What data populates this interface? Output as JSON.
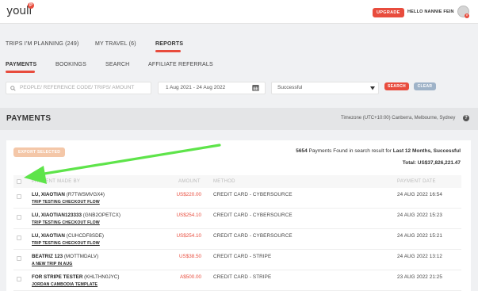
{
  "header": {
    "logo_text": "youli",
    "logo_mark": "P",
    "upgrade_label": "UPGRADE",
    "greeting": "HELLO NANNIE FEIN",
    "avatar_icon": "user-avatar-icon",
    "avatar_badge": "×"
  },
  "nav": {
    "tabs": [
      {
        "label": "TRIPS I'M PLANNING (249)"
      },
      {
        "label": "MY TRAVEL (6)"
      },
      {
        "label": "REPORTS"
      }
    ],
    "subtabs": [
      {
        "label": "PAYMENTS"
      },
      {
        "label": "BOOKINGS"
      },
      {
        "label": "SEARCH"
      },
      {
        "label": "AFFILIATE REFERRALS"
      }
    ]
  },
  "filters": {
    "search_placeholder": "PEOPLE/ REFERENCE CODE/ TRIPS/ AMOUNT",
    "date_range": "1 Aug 2021 - 24 Aug 2022",
    "status": "Successful",
    "search_label": "SEARCH",
    "clear_label": "CLEAR"
  },
  "section": {
    "title": "PAYMENTS",
    "timezone": "Timezone (UTC+10:00) Canberra, Melbourne, Sydney",
    "info_icon": "?"
  },
  "results": {
    "export_label": "EXPORT SELECTED",
    "count": "5654",
    "found_text": " Payments Found in search result for ",
    "range_text": "Last 12 Months, Successful",
    "total_text": "Total: US$37,826,221.47"
  },
  "table": {
    "headers": {
      "made_by": "PAYMENT MADE BY",
      "amount": "AMOUNT",
      "method": "METHOD",
      "date": "PAYMENT DATE"
    },
    "rows": [
      {
        "name": "LU, XIAOTIAN",
        "ref": "(R7TWSMVGX4)",
        "trip": "TRIP TESTING CHECKOUT FLOW",
        "amount": "US$220.00",
        "method": "CREDIT CARD - CYBERSOURCE",
        "date": "24 AUG 2022 16:54"
      },
      {
        "name": "LU, XIAOTIAN123333",
        "ref": "(GNB2OPETCX)",
        "trip": "TRIP TESTING CHECKOUT FLOW",
        "amount": "US$254.10",
        "method": "CREDIT CARD - CYBERSOURCE",
        "date": "24 AUG 2022 15:23"
      },
      {
        "name": "LU, XIAOTIAN",
        "ref": "(CUHCDF8SDE)",
        "trip": "TRIP TESTING CHECKOUT FLOW",
        "amount": "US$254.10",
        "method": "CREDIT CARD - CYBERSOURCE",
        "date": "24 AUG 2022 15:21"
      },
      {
        "name": "BEATRIZ 123",
        "ref": "(MOTTMDALV)",
        "trip": "A NEW TRIP IN AUG",
        "amount": "US$38.50",
        "method": "CREDIT CARD - STRIPE",
        "date": "24 AUG 2022 13:12"
      },
      {
        "name": "FOR STRIPE TESTER",
        "ref": "(KHLTHN0JYC)",
        "trip": "JORDAN CAMBODIA TEMPLATE",
        "amount": "A$500.00",
        "method": "CREDIT CARD - STRIPE",
        "date": "23 AUG 2022 21:25"
      }
    ]
  },
  "colors": {
    "accent": "#e84c3d",
    "arrow": "#5ee44a",
    "export_bg": "#f4c7a8",
    "clear_bg": "#9fb3c8"
  }
}
